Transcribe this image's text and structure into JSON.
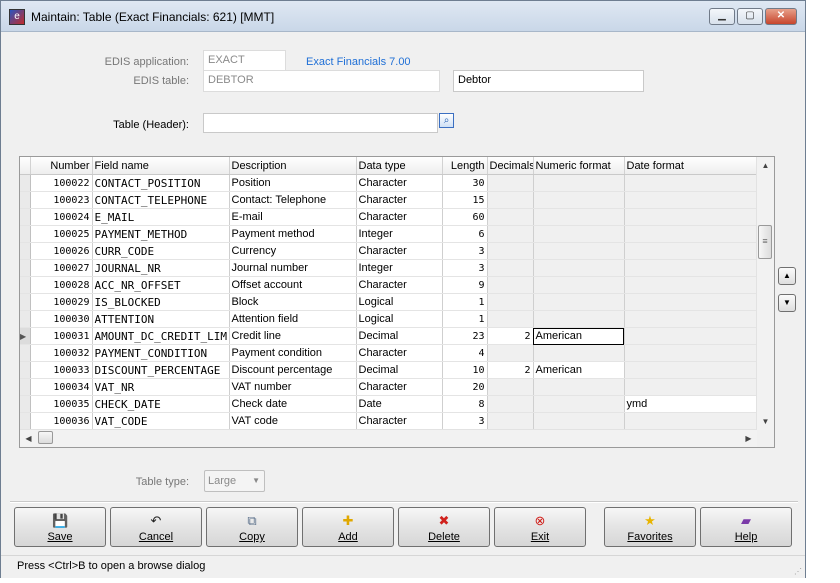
{
  "window": {
    "title": "Maintain: Table (Exact Financials: 621) [MMT]",
    "controls": [
      "minimize",
      "maximize",
      "close"
    ]
  },
  "form": {
    "edis_application_label": "EDIS application:",
    "edis_application_value": "EXACT",
    "edis_application_link": "Exact Financials 7.00",
    "edis_table_label": "EDIS table:",
    "edis_table_value": "DEBTOR",
    "edis_table_description": "Debtor",
    "table_header_label": "Table (Header):",
    "table_header_value": ""
  },
  "grid": {
    "columns": [
      "Number",
      "Field name",
      "Description",
      "Data type",
      "Length",
      "Decimals",
      "Numeric format",
      "Date format"
    ],
    "rows": [
      {
        "number": "100022",
        "field_name": "CONTACT_POSITION",
        "description": "Position",
        "data_type": "Character",
        "length": "30",
        "decimals": "",
        "numeric_format": "",
        "date_format": ""
      },
      {
        "number": "100023",
        "field_name": "CONTACT_TELEPHONE",
        "description": "Contact: Telephone",
        "data_type": "Character",
        "length": "15",
        "decimals": "",
        "numeric_format": "",
        "date_format": ""
      },
      {
        "number": "100024",
        "field_name": "E_MAIL",
        "description": "E-mail",
        "data_type": "Character",
        "length": "60",
        "decimals": "",
        "numeric_format": "",
        "date_format": ""
      },
      {
        "number": "100025",
        "field_name": "PAYMENT_METHOD",
        "description": "Payment method",
        "data_type": "Integer",
        "length": "6",
        "decimals": "",
        "numeric_format": "",
        "date_format": ""
      },
      {
        "number": "100026",
        "field_name": "CURR_CODE",
        "description": "Currency",
        "data_type": "Character",
        "length": "3",
        "decimals": "",
        "numeric_format": "",
        "date_format": ""
      },
      {
        "number": "100027",
        "field_name": "JOURNAL_NR",
        "description": "Journal number",
        "data_type": "Integer",
        "length": "3",
        "decimals": "",
        "numeric_format": "",
        "date_format": ""
      },
      {
        "number": "100028",
        "field_name": "ACC_NR_OFFSET",
        "description": "Offset account",
        "data_type": "Character",
        "length": "9",
        "decimals": "",
        "numeric_format": "",
        "date_format": ""
      },
      {
        "number": "100029",
        "field_name": "IS_BLOCKED",
        "description": "Block",
        "data_type": "Logical",
        "length": "1",
        "decimals": "",
        "numeric_format": "",
        "date_format": ""
      },
      {
        "number": "100030",
        "field_name": "ATTENTION",
        "description": "Attention field",
        "data_type": "Logical",
        "length": "1",
        "decimals": "",
        "numeric_format": "",
        "date_format": ""
      },
      {
        "number": "100031",
        "field_name": "AMOUNT_DC_CREDIT_LIM",
        "description": "Credit line",
        "data_type": "Decimal",
        "length": "23",
        "decimals": "2",
        "numeric_format": "American",
        "date_format": ""
      },
      {
        "number": "100032",
        "field_name": "PAYMENT_CONDITION",
        "description": "Payment condition",
        "data_type": "Character",
        "length": "4",
        "decimals": "",
        "numeric_format": "",
        "date_format": ""
      },
      {
        "number": "100033",
        "field_name": "DISCOUNT_PERCENTAGE",
        "description": "Discount percentage",
        "data_type": "Decimal",
        "length": "10",
        "decimals": "2",
        "numeric_format": "American",
        "date_format": ""
      },
      {
        "number": "100034",
        "field_name": "VAT_NR",
        "description": "VAT number",
        "data_type": "Character",
        "length": "20",
        "decimals": "",
        "numeric_format": "",
        "date_format": ""
      },
      {
        "number": "100035",
        "field_name": "CHECK_DATE",
        "description": "Check date",
        "data_type": "Date",
        "length": "8",
        "decimals": "",
        "numeric_format": "",
        "date_format": "ymd"
      },
      {
        "number": "100036",
        "field_name": "VAT_CODE",
        "description": "VAT code",
        "data_type": "Character",
        "length": "3",
        "decimals": "",
        "numeric_format": "",
        "date_format": ""
      }
    ],
    "current_row_number": "100031"
  },
  "table_type": {
    "label": "Table type:",
    "value": "Large"
  },
  "buttons": [
    {
      "id": "save",
      "label": "Save",
      "icon": "floppy-disk-icon",
      "glyph": "💾",
      "color": "#2b5797"
    },
    {
      "id": "cancel",
      "label": "Cancel",
      "icon": "undo-icon",
      "glyph": "↶",
      "color": "#222222"
    },
    {
      "id": "copy",
      "label": "Copy",
      "icon": "copy-icon",
      "glyph": "⧉",
      "color": "#5a6f8a"
    },
    {
      "id": "add",
      "label": "Add",
      "icon": "add-icon",
      "glyph": "✚",
      "color": "#e0a800"
    },
    {
      "id": "delete",
      "label": "Delete",
      "icon": "delete-icon",
      "glyph": "✖",
      "color": "#d0211c"
    },
    {
      "id": "exit",
      "label": "Exit",
      "icon": "exit-icon",
      "glyph": "⊗",
      "color": "#d0211c"
    },
    {
      "id": "favorites",
      "label": "Favorites",
      "icon": "star-icon",
      "glyph": "★",
      "color": "#e8b400"
    },
    {
      "id": "help",
      "label": "Help",
      "icon": "help-book-icon",
      "glyph": "▰",
      "color": "#7a3aa8"
    }
  ],
  "status": {
    "text": "Press <Ctrl>B to open a browse dialog"
  }
}
